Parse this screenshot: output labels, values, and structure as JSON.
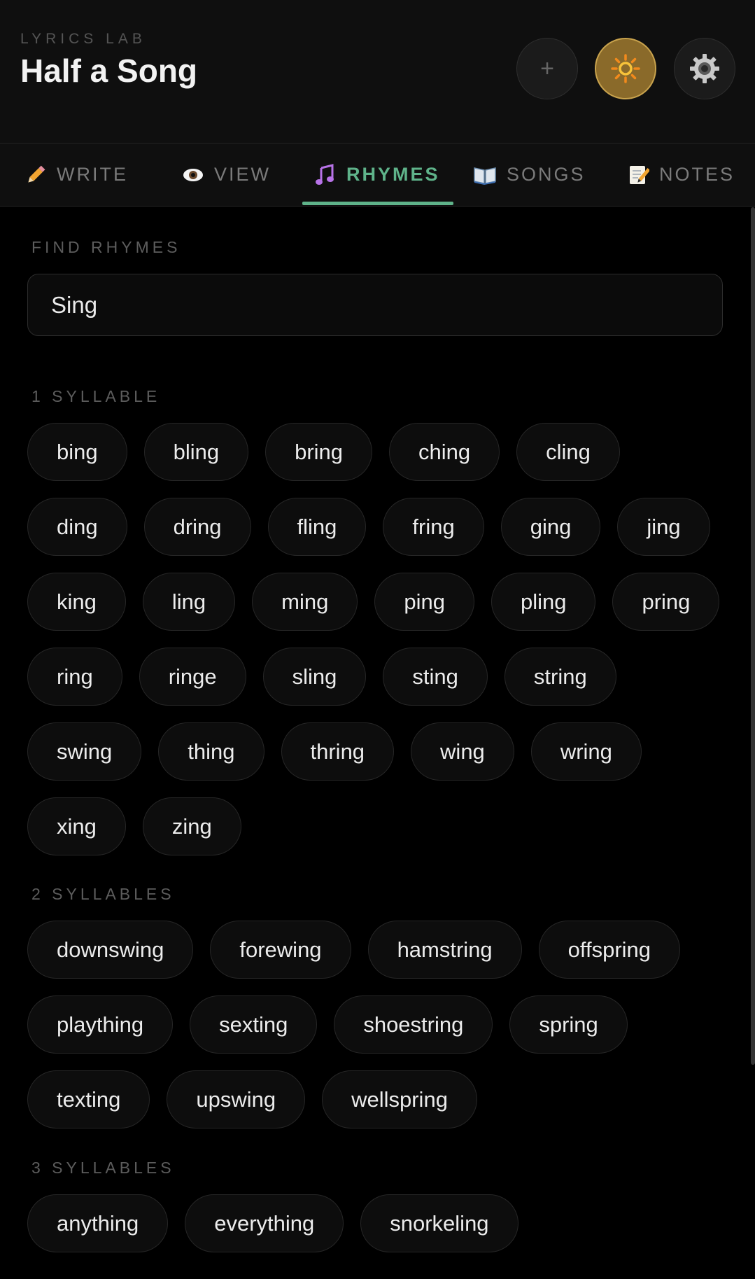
{
  "header": {
    "app_label": "LYRICS LAB",
    "title": "Half a Song",
    "add_symbol": "+"
  },
  "tabs": [
    {
      "label": "WRITE",
      "icon": "pencil-icon"
    },
    {
      "label": "VIEW",
      "icon": "eye-icon"
    },
    {
      "label": "RHYMES",
      "icon": "music-note-icon",
      "active": true
    },
    {
      "label": "SONGS",
      "icon": "book-icon"
    },
    {
      "label": "NOTES",
      "icon": "memo-icon"
    }
  ],
  "search": {
    "label": "FIND RHYMES",
    "value": "Sing"
  },
  "groups": [
    {
      "label": "1 SYLLABLE",
      "words": [
        "bing",
        "bling",
        "bring",
        "ching",
        "cling",
        "ding",
        "dring",
        "fling",
        "fring",
        "ging",
        "jing",
        "king",
        "ling",
        "ming",
        "ping",
        "pling",
        "pring",
        "ring",
        "ringe",
        "sling",
        "sting",
        "string",
        "swing",
        "thing",
        "thring",
        "wing",
        "wring",
        "xing",
        "zing"
      ]
    },
    {
      "label": "2 SYLLABLES",
      "words": [
        "downswing",
        "forewing",
        "hamstring",
        "offspring",
        "plaything",
        "sexting",
        "shoestring",
        "spring",
        "texting",
        "upswing",
        "wellspring"
      ]
    },
    {
      "label": "3 SYLLABLES",
      "words": [
        "anything",
        "everything",
        "snorkeling"
      ]
    }
  ],
  "colors": {
    "accent": "#5fb38a",
    "sun_button": "#8a6a2a"
  }
}
